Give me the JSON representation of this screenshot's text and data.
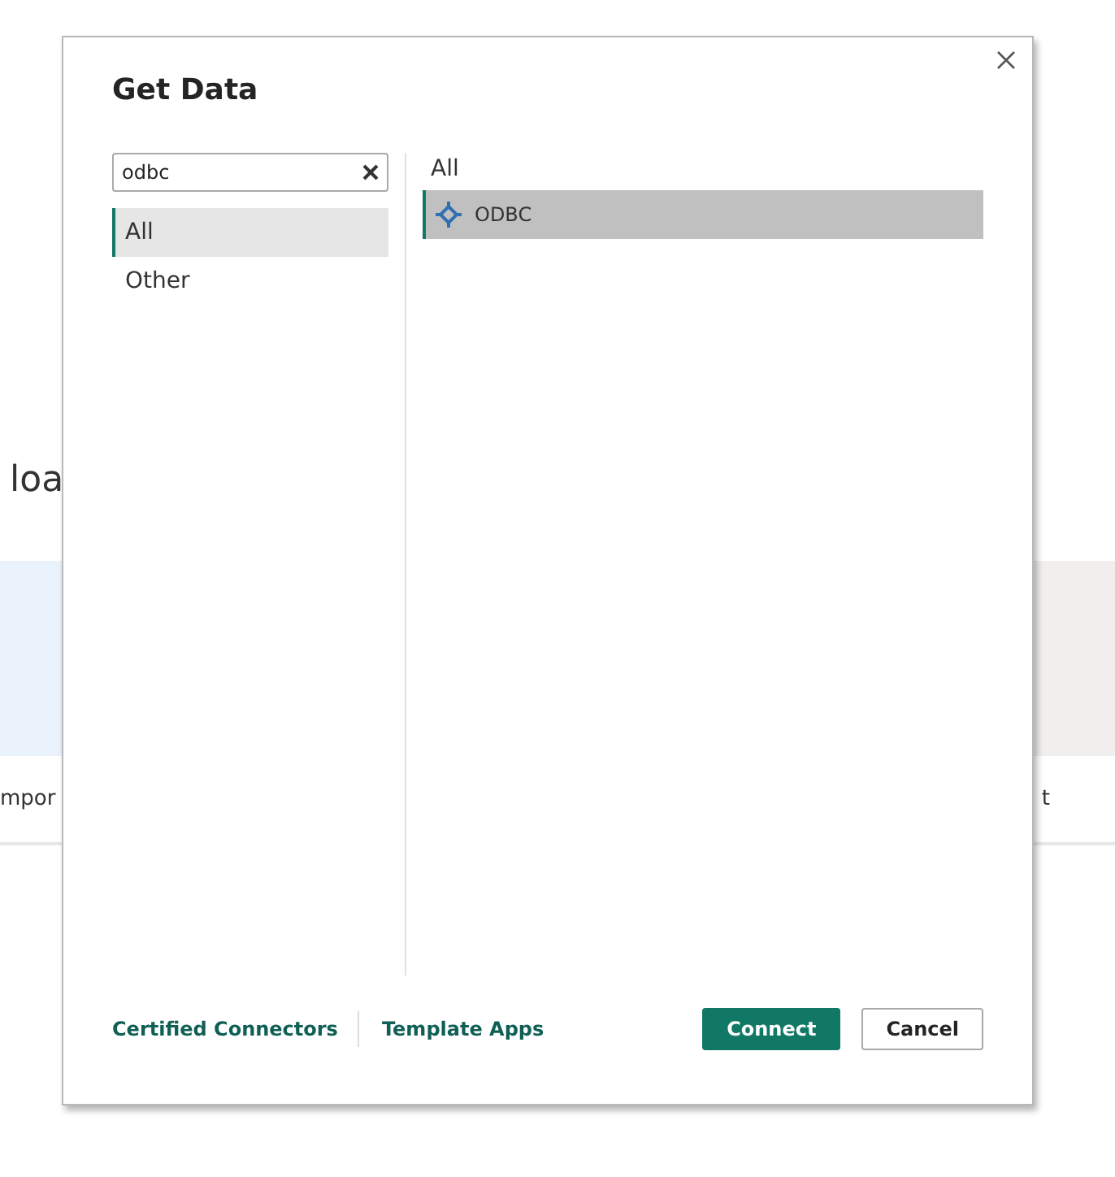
{
  "background": {
    "heading": "loa",
    "left_caption": "mpor",
    "right_caption": "t"
  },
  "dialog": {
    "title": "Get Data",
    "search": {
      "value": "odbc"
    },
    "categories": [
      {
        "label": "All",
        "selected": true
      },
      {
        "label": "Other",
        "selected": false
      }
    ],
    "results_heading": "All",
    "results": [
      {
        "label": "ODBC",
        "selected": true
      }
    ],
    "footer_links": [
      "Certified Connectors",
      "Template Apps"
    ],
    "buttons": [
      {
        "label": "Connect",
        "kind": "primary"
      },
      {
        "label": "Cancel",
        "kind": "secondary"
      }
    ]
  }
}
